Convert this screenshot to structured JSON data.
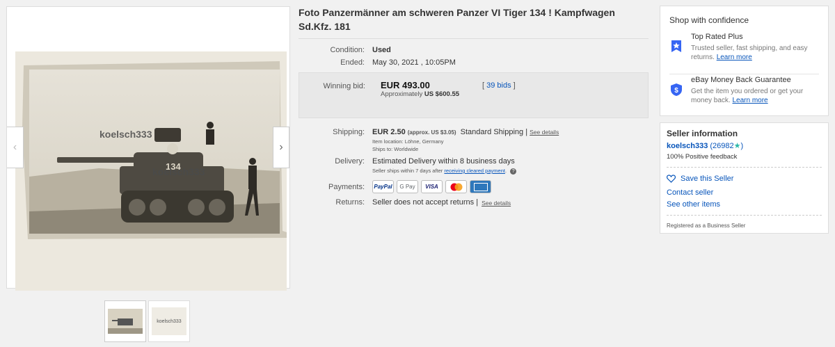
{
  "viewer": {
    "watermark": "koelsch333",
    "prev_arrow": "‹",
    "next_arrow": "›",
    "thumb2_text": "koelsch333"
  },
  "item": {
    "title": "Foto Panzermänner am schweren Panzer VI Tiger 134 ! Kampfwagen Sd.Kfz. 181",
    "condition_label": "Condition:",
    "condition_value": "Used",
    "ended_label": "Ended:",
    "ended_value": "May 30, 2021 , 10:05PM",
    "winning_bid_label": "Winning bid:",
    "winning_bid": "EUR 493.00",
    "approx_prefix": "Approximately",
    "approx_value": "US $600.55",
    "bids_open": "[ ",
    "bids_link": "39 bids",
    "bids_close": " ]",
    "shipping_label": "Shipping:",
    "shipping_cost": "EUR 2.50",
    "shipping_approx": "(approx. US $3.05)",
    "shipping_method": "Standard Shipping |",
    "see_details": "See details",
    "item_location": "Item location:  Löhne, Germany",
    "ships_to": "Ships to:  Worldwide",
    "delivery_label": "Delivery:",
    "delivery_value": "Estimated Delivery within 8 business days",
    "delivery_note": "Seller ships within 7 days after",
    "delivery_note_link": "receiving cleared payment",
    "delivery_note_end": ".",
    "payments_label": "Payments:",
    "payments": [
      "PayPal",
      "G Pay",
      "VISA",
      "Mastercard",
      "AMEX"
    ],
    "returns_label": "Returns:",
    "returns_value": "Seller does not accept returns |",
    "returns_see_details": "See details"
  },
  "confidence": {
    "heading": "Shop with confidence",
    "top_rated_title": "Top Rated Plus",
    "top_rated_desc": "Trusted seller, fast shipping, and easy returns.",
    "learn_more": "Learn more",
    "guarantee_title": "eBay Money Back Guarantee",
    "guarantee_desc": "Get the item you ordered or get your money back.",
    "learn_more2": "Learn more"
  },
  "seller": {
    "heading": "Seller information",
    "name": "koelsch333",
    "score": "(26982",
    "score_close": ")",
    "feedback": "100% Positive feedback",
    "save_label": "Save this Seller",
    "contact_label": "Contact seller",
    "other_items": "See other items",
    "registered": "Registered as a Business Seller"
  },
  "colors": {
    "link": "#0654ba",
    "star": "#2ab7a9",
    "shield": "#3665f3"
  }
}
